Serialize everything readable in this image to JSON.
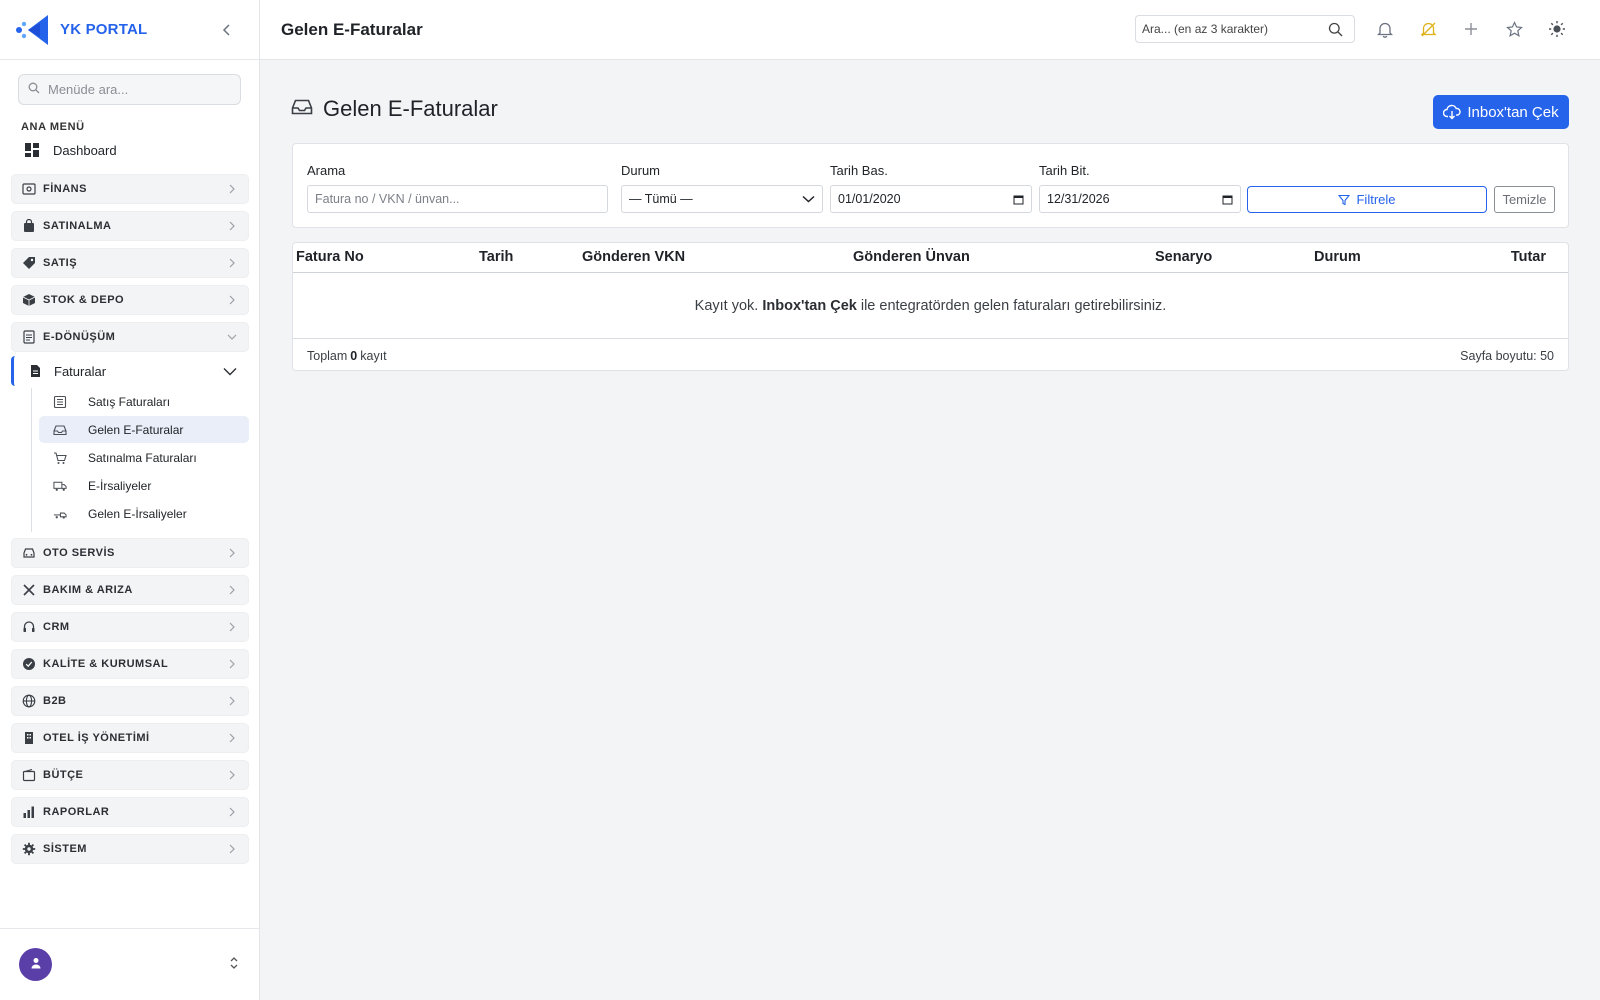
{
  "brand": {
    "name": "YK PORTAL"
  },
  "sidebar": {
    "search_placeholder": "Menüde ara...",
    "section_title": "ANA MENÜ",
    "dashboard_label": "Dashboard",
    "groups": [
      {
        "label": "FİNANS",
        "icon": "finance-icon"
      },
      {
        "label": "SATINALMA",
        "icon": "bag-icon"
      },
      {
        "label": "SATIŞ",
        "icon": "tag-icon"
      },
      {
        "label": "STOK & DEPO",
        "icon": "box-icon"
      },
      {
        "label": "E-DÖNÜŞÜM",
        "icon": "document-icon",
        "expanded": true
      },
      {
        "label": "OTO SERVİS",
        "icon": "car-icon"
      },
      {
        "label": "BAKIM & ARIZA",
        "icon": "tools-icon"
      },
      {
        "label": "CRM",
        "icon": "headset-icon"
      },
      {
        "label": "KALİTE & KURUMSAL",
        "icon": "badge-check-icon"
      },
      {
        "label": "B2B",
        "icon": "globe-icon"
      },
      {
        "label": "OTEL İŞ YÖNETİMİ",
        "icon": "building-icon"
      },
      {
        "label": "BÜTÇE",
        "icon": "wallet-icon"
      },
      {
        "label": "RAPORLAR",
        "icon": "bar-chart-icon"
      },
      {
        "label": "SİSTEM",
        "icon": "gear-icon"
      }
    ],
    "sub_parent": {
      "label": "Faturalar",
      "icon": "invoice-icon"
    },
    "sub_items": [
      {
        "label": "Satış Faturaları",
        "icon": "receipt-icon"
      },
      {
        "label": "Gelen E-Faturalar",
        "icon": "inbox-icon",
        "active": true
      },
      {
        "label": "Satınalma Faturaları",
        "icon": "cart-icon"
      },
      {
        "label": "E-İrsaliyeler",
        "icon": "truck-icon"
      },
      {
        "label": "Gelen E-İrsaliyeler",
        "icon": "truck-incoming-icon"
      }
    ]
  },
  "topbar": {
    "page_title": "Gelen E-Faturalar",
    "search_placeholder": "Ara... (en az 3 karakter)"
  },
  "main": {
    "heading": "Gelen E-Faturalar",
    "inbox_button": "Inbox'tan Çek",
    "filters": {
      "search_label": "Arama",
      "search_placeholder": "Fatura no / VKN / ünvan...",
      "status_label": "Durum",
      "status_value": "— Tümü —",
      "date_start_label": "Tarih Bas.",
      "date_start_value": "01/01/2020",
      "date_end_label": "Tarih Bit.",
      "date_end_value": "12/31/2026",
      "filter_button": "Filtrele",
      "clear_button": "Temizle"
    },
    "table": {
      "columns": [
        "Fatura No",
        "Tarih",
        "Gönderen VKN",
        "Gönderen Ünvan",
        "Senaryo",
        "Durum",
        "Tutar"
      ],
      "empty_prefix": "Kayıt yok.",
      "empty_link": "Inbox'tan Çek",
      "empty_suffix": "ile entegratörden gelen faturaları getirebilirsiniz.",
      "footer_prefix": "Toplam",
      "footer_count": "0",
      "footer_suffix": "kayıt",
      "page_size": "Sayfa boyutu: 50"
    }
  },
  "colors": {
    "accent": "#2563eb",
    "avatar": "#5b3fa8",
    "bell_warning": "#e0b21a"
  }
}
